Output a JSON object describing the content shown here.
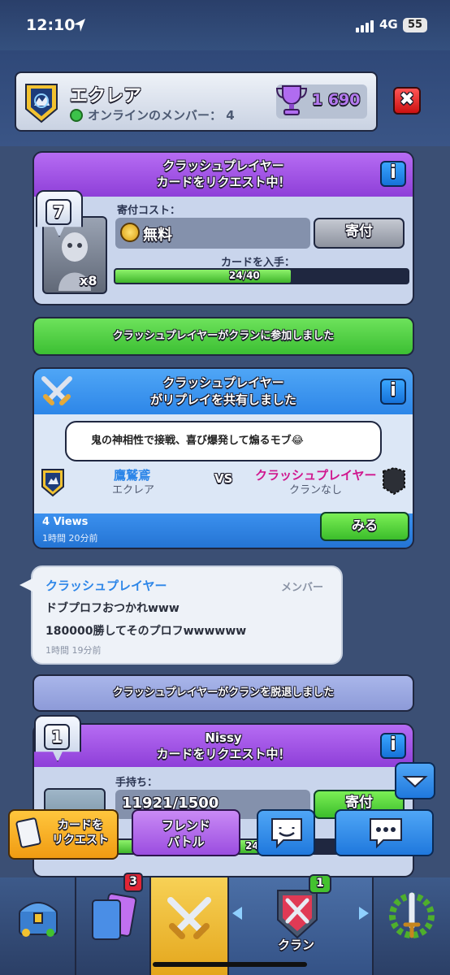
{
  "status": {
    "time": "12:10",
    "network": "4G",
    "battery": "55"
  },
  "header": {
    "clan_name": "エクレア",
    "online_label": "オンラインのメンバー： 4",
    "trophies": "1 690"
  },
  "request1": {
    "title_line1": "クラッシュプレイヤー",
    "title_line2": "カードをリクエスト中！",
    "level": "7",
    "donate_cost_label": "寄付コスト：",
    "cost_value": "無料",
    "donate_button": "寄付",
    "card_count": "x8",
    "progress_label": "カードを入手：",
    "progress_text": "24/40",
    "progress_fraction": 0.6
  },
  "joined_banner": "クラッシュプレイヤーがクランに参加しました",
  "replay": {
    "title_line1": "クラッシュプレイヤー",
    "title_line2": "がリプレイを共有しました",
    "comment": "鬼の神相性で接戦、喜び爆発して煽るモブ😂",
    "player1_name": "鷹鷲鳶",
    "player1_clan": "エクレア",
    "vs": "VS",
    "player2_name": "クラッシュプレイヤー",
    "player2_clan": "クランなし",
    "views": "4 Views",
    "time": "1時間 20分前",
    "watch_button": "みる"
  },
  "chat": {
    "sender": "クラッシュプレイヤー",
    "role": "メンバー",
    "line1": "ドブプロフおつかれwww",
    "line2": "180000勝してそのプロフwwwwww",
    "time": "1時間 19分前"
  },
  "left_banner": "クラッシュプレイヤーがクランを脱退しました",
  "request2": {
    "title_line1": "Nissy",
    "title_line2": "カードをリクエスト中！",
    "level": "1",
    "hand_label": "手持ち：",
    "hand_value": "11921/1500",
    "donate_button": "寄付",
    "progress_text": "24/40"
  },
  "actions": {
    "request_card": "カードを\nリクエスト",
    "friend_battle_line1": "フレンド",
    "friend_battle_line2": "バトル"
  },
  "nav": {
    "cards_badge": "3",
    "clan_badge": "1",
    "clan_label": "クラン"
  },
  "colors": {
    "accent_purple": "#9b4de0",
    "accent_blue": "#2d86e8",
    "accent_green": "#43c22f",
    "background": "#3b4f74"
  }
}
